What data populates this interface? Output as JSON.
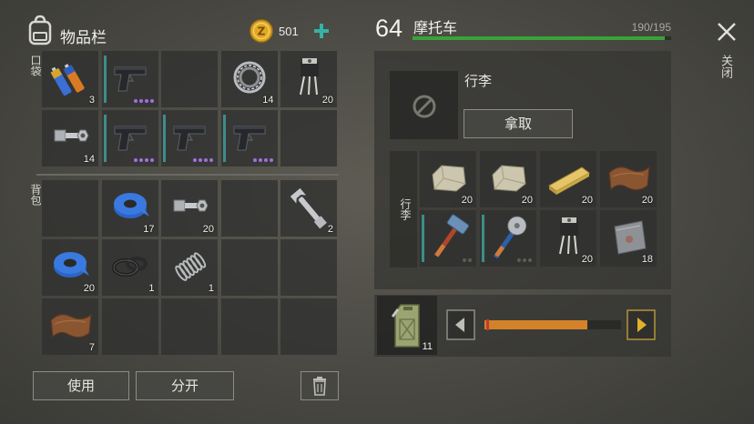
{
  "inventory": {
    "title": "物品栏",
    "coins": "501",
    "pockets_label": "口袋",
    "backpack_label": "背包",
    "pockets": [
      {
        "icon": "batteries-icon",
        "count": "3"
      },
      {
        "icon": "pistol-icon",
        "count": "",
        "dots": 4
      },
      {
        "icon": "",
        "count": ""
      },
      {
        "icon": "bearing-icon",
        "count": "14"
      },
      {
        "icon": "transistor-icon",
        "count": "20"
      },
      {
        "icon": "bolt-nut-icon",
        "count": "14"
      },
      {
        "icon": "pistol-icon",
        "count": "",
        "dots": 4
      },
      {
        "icon": "pistol-icon",
        "count": "",
        "dots": 4
      },
      {
        "icon": "pistol-icon",
        "count": "",
        "dots": 4
      },
      {
        "icon": "",
        "count": ""
      }
    ],
    "backpack": [
      {
        "icon": "",
        "count": ""
      },
      {
        "icon": "blue-tape-icon",
        "count": "17"
      },
      {
        "icon": "bolt-nut-icon",
        "count": "20"
      },
      {
        "icon": "",
        "count": ""
      },
      {
        "icon": "wrench-icon",
        "count": "2"
      },
      {
        "icon": "blue-tape-icon",
        "count": "20"
      },
      {
        "icon": "rubber-rings-icon",
        "count": "1"
      },
      {
        "icon": "spring-icon",
        "count": "1"
      },
      {
        "icon": "",
        "count": ""
      },
      {
        "icon": "",
        "count": ""
      },
      {
        "icon": "leather-icon",
        "count": "7"
      },
      {
        "icon": "",
        "count": ""
      },
      {
        "icon": "",
        "count": ""
      },
      {
        "icon": "",
        "count": ""
      },
      {
        "icon": "",
        "count": ""
      }
    ],
    "use_label": "使用",
    "split_label": "分开"
  },
  "vehicle": {
    "level": "64",
    "name": "摩托车",
    "capacity": "190/195",
    "capacity_fraction": 0.974,
    "luggage_slot_title": "行李",
    "take_label": "拿取",
    "luggage_label": "行李",
    "luggage": [
      {
        "icon": "stone-icon",
        "count": "20"
      },
      {
        "icon": "stone-icon",
        "count": "20"
      },
      {
        "icon": "wood-plank-icon",
        "count": "20"
      },
      {
        "icon": "leather-icon",
        "count": "20"
      },
      {
        "icon": "sledgehammer-icon",
        "count": "",
        "dots": 2
      },
      {
        "icon": "saw-blade-weapon-icon",
        "count": "",
        "dots": 3
      },
      {
        "icon": "transistor-icon",
        "count": "20"
      },
      {
        "icon": "metal-plate-icon",
        "count": "18"
      }
    ],
    "fuel_count": "11",
    "fuel_fraction": 0.75
  },
  "close_label": "关闭",
  "colors": {
    "capacity_bar": "#3aa23a",
    "fuel_bar": "#d3822a",
    "durability": "#3d8d8a",
    "dots": "#a070e0",
    "arrow_right": "#e0b22a"
  }
}
